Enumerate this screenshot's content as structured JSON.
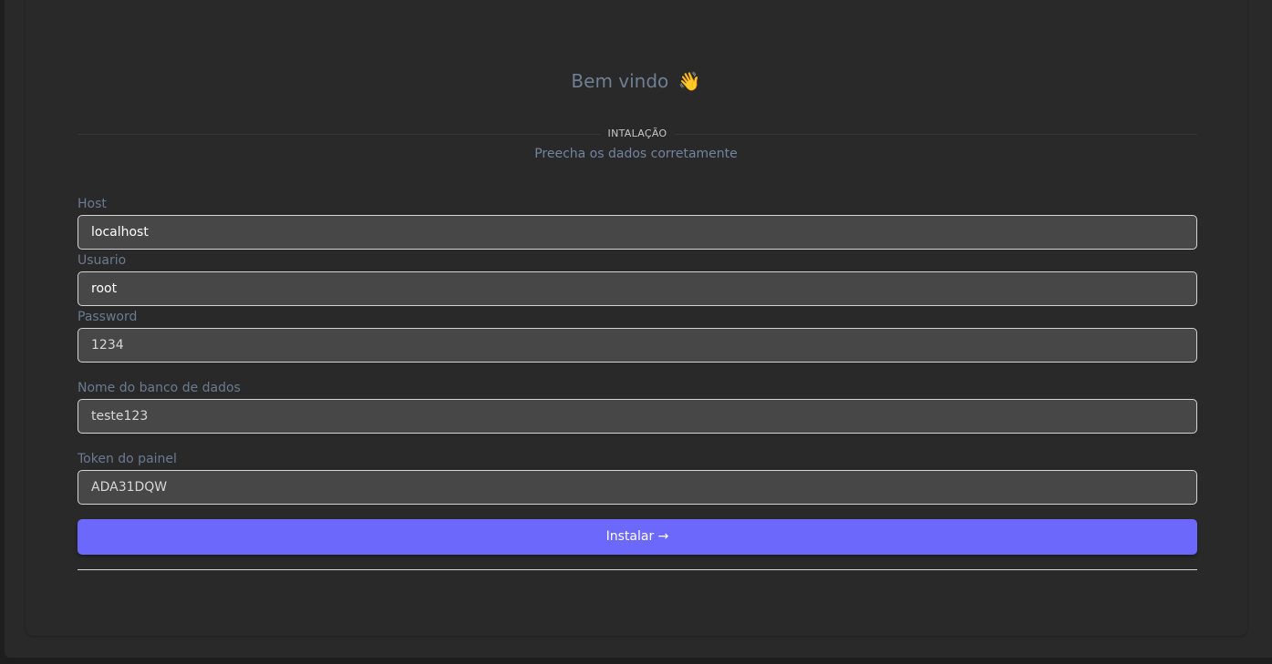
{
  "header": {
    "title": "Bem vindo",
    "wave_emoji": "👋"
  },
  "divider": {
    "label": "INTALAÇÃO"
  },
  "subtitle": "Preecha os dados corretamente",
  "form": {
    "host": {
      "label": "Host",
      "value": "localhost"
    },
    "user": {
      "label": "Usuario",
      "value": "root"
    },
    "password": {
      "label": "Password",
      "value": "1234"
    },
    "database": {
      "label": "Nome do banco de dados",
      "value": "teste123"
    },
    "token": {
      "label": "Token do painel",
      "value": "ADA31DQW"
    }
  },
  "submit": {
    "label": "Instalar",
    "arrow": "→"
  },
  "colors": {
    "accent": "#6c68fc",
    "background": "#292929",
    "field_bg": "#474747"
  }
}
